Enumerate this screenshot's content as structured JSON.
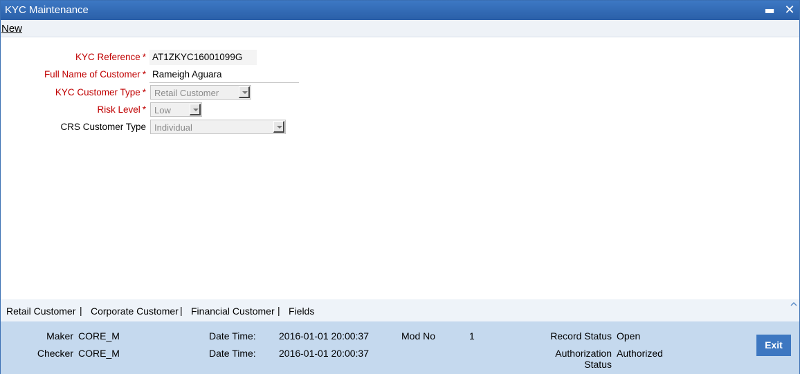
{
  "window": {
    "title": "KYC Maintenance",
    "minimize_glyph": "▬",
    "close_glyph": "✕"
  },
  "toolbar": {
    "new_label": "New"
  },
  "form": {
    "kyc_reference": {
      "label": "KYC Reference",
      "required_mark": "*",
      "value": "AT1ZKYC16001099G"
    },
    "full_name": {
      "label": "Full Name of Customer",
      "required_mark": "*",
      "value": "Rameigh Aguara"
    },
    "kyc_customer_type": {
      "label": "KYC Customer Type",
      "required_mark": "*",
      "value": "Retail Customer"
    },
    "risk_level": {
      "label": "Risk Level",
      "required_mark": "*",
      "value": "Low"
    },
    "crs_customer_type": {
      "label": "CRS Customer Type",
      "value": "Individual"
    }
  },
  "tabs": {
    "items": [
      "Retail Customer",
      "Corporate Customer",
      "Financial Customer",
      "Fields"
    ],
    "separator": "|"
  },
  "footer": {
    "maker_label": "Maker",
    "maker_value": "CORE_M",
    "checker_label": "Checker",
    "checker_value": "CORE_M",
    "date_time_label": "Date Time:",
    "maker_date_time": "2016-01-01 20:00:37",
    "checker_date_time": "2016-01-01 20:00:37",
    "mod_no_label": "Mod No",
    "mod_no_value": "1",
    "record_status_label": "Record Status",
    "record_status_value": "Open",
    "authorization_status_label_1": "Authorization",
    "authorization_status_label_2": "Status",
    "authorization_status_value": "Authorized",
    "exit_label": "Exit"
  },
  "colors": {
    "titlebar": "#2f68b4",
    "required_label": "#c00000",
    "footer_bg": "#c5d9ee",
    "exit_button": "#3d77c1"
  }
}
